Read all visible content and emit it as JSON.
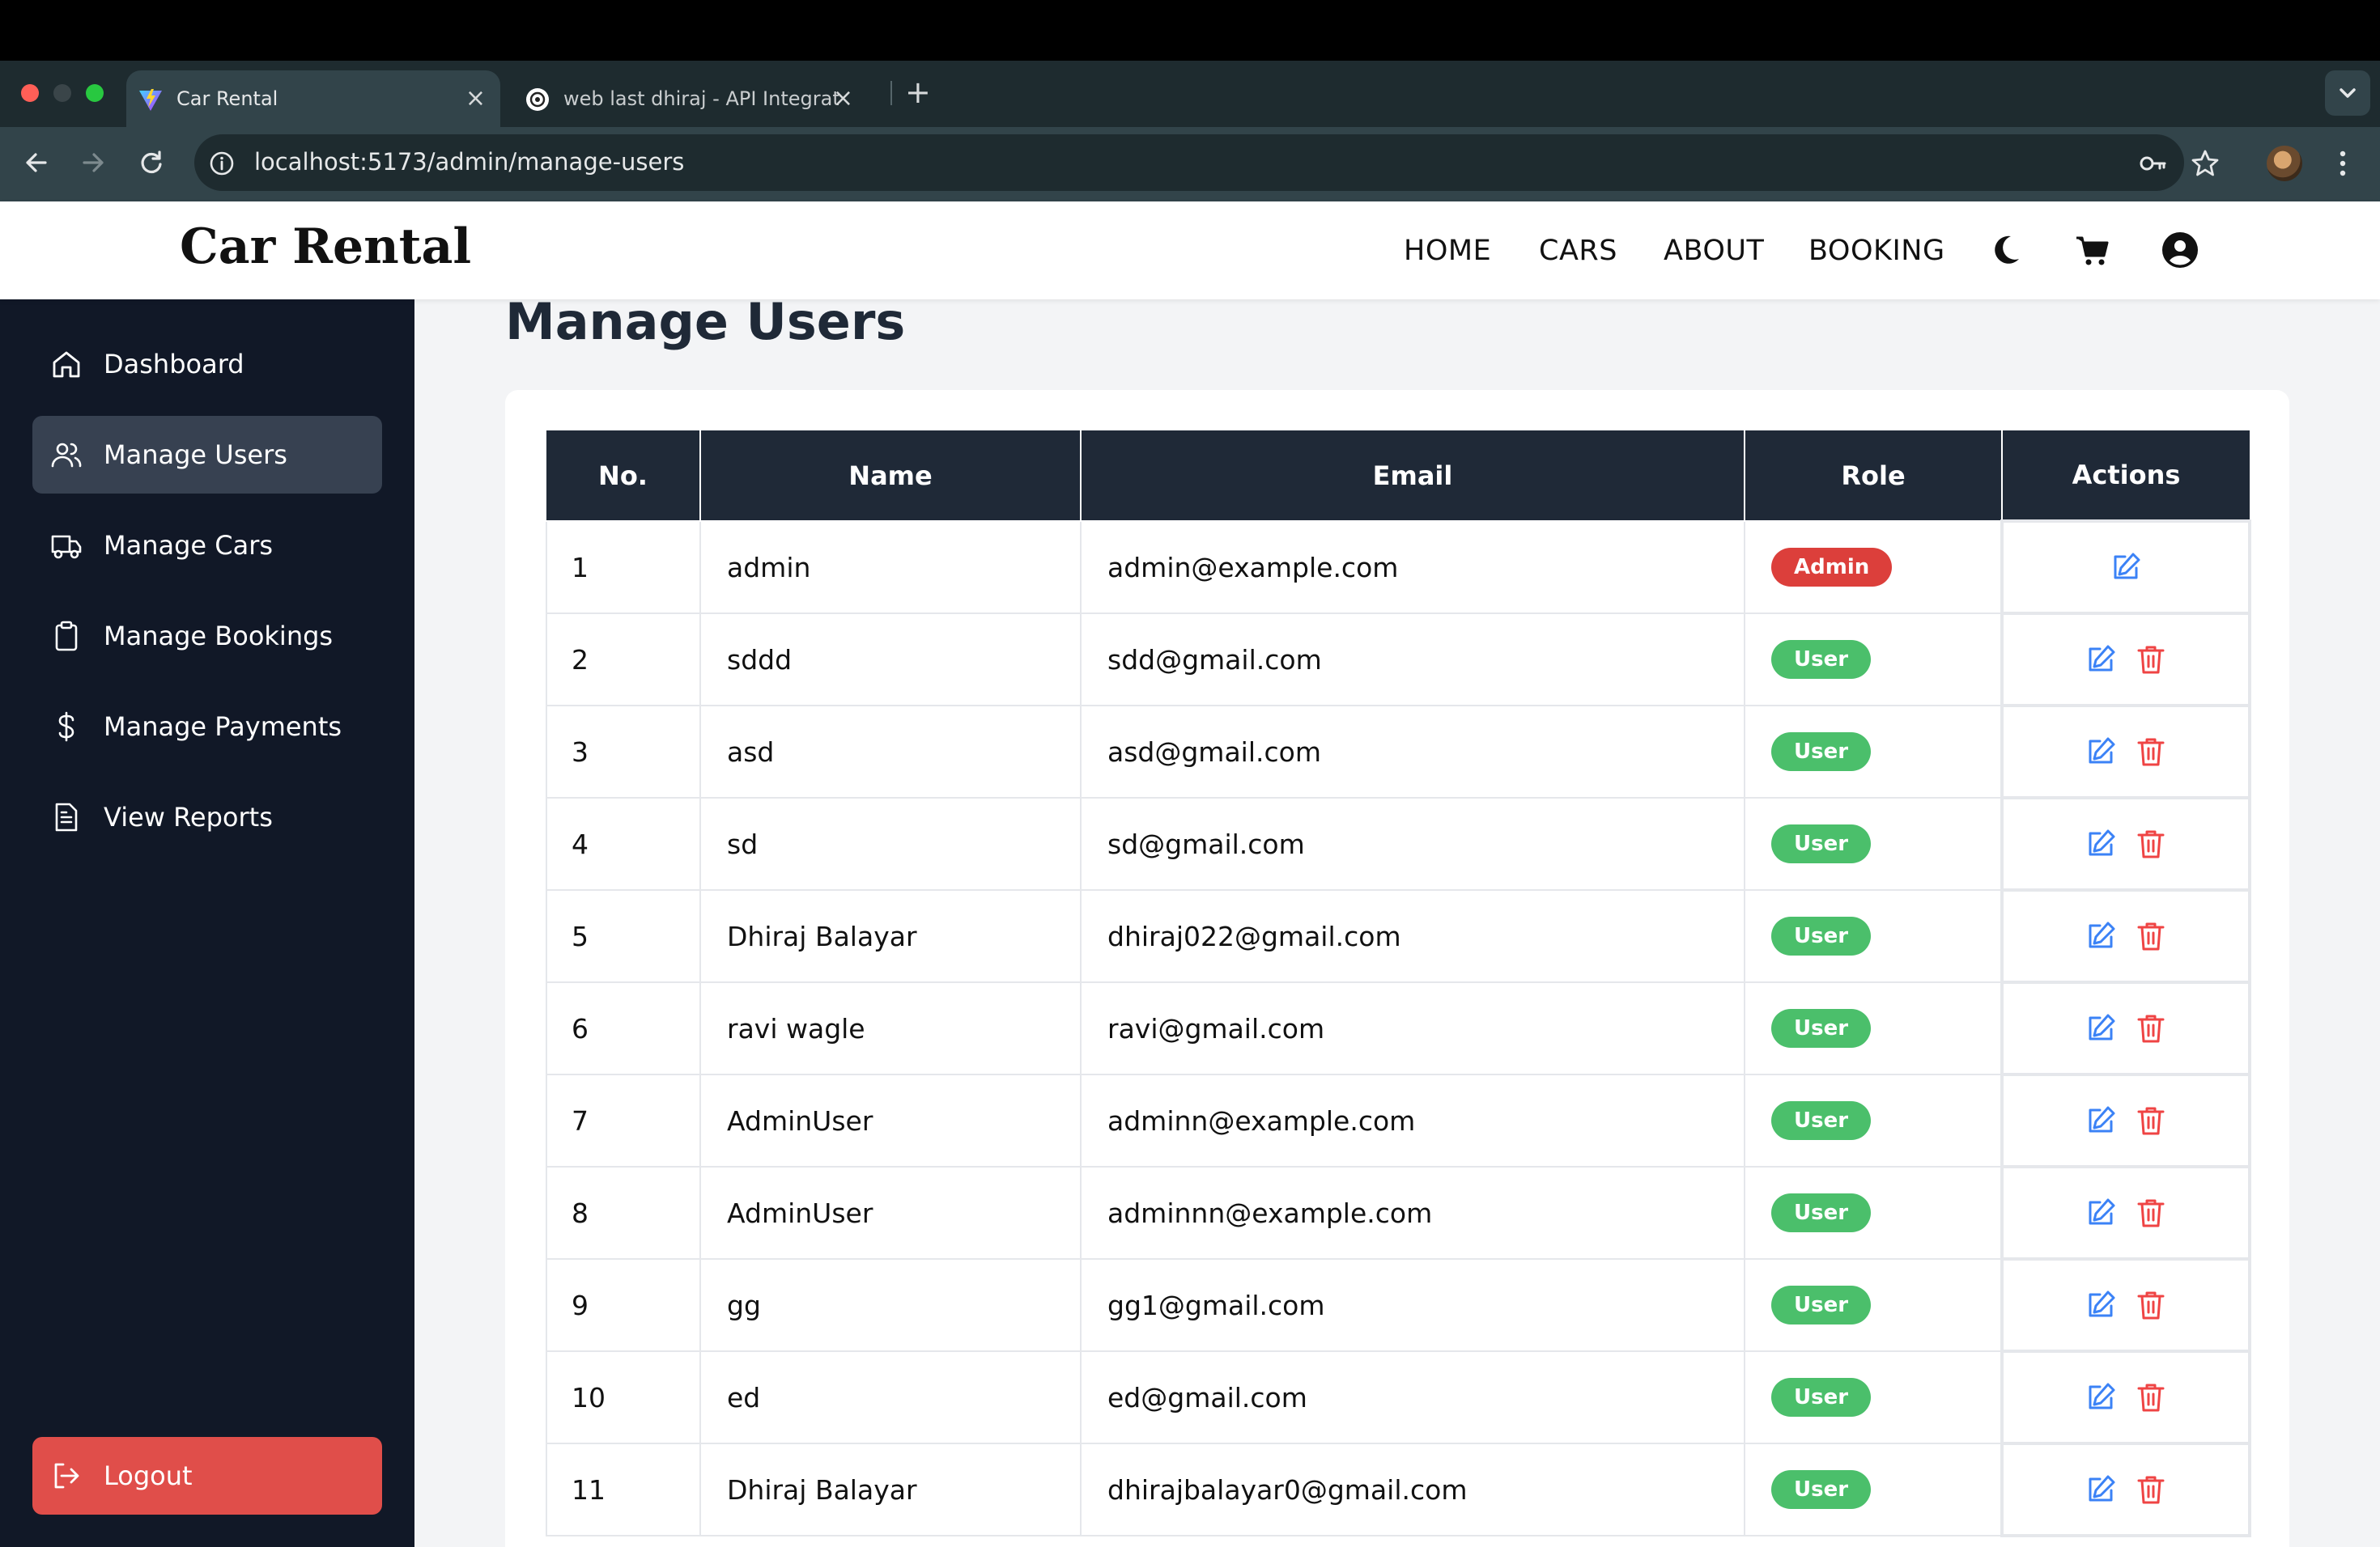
{
  "browser": {
    "tabs": [
      {
        "title": "Car Rental",
        "active": true
      },
      {
        "title": "web last dhiraj - API Integratio",
        "active": false
      }
    ],
    "url": "localhost:5173/admin/manage-users"
  },
  "navbar": {
    "brand": "Car Rental",
    "links": [
      {
        "label": "HOME"
      },
      {
        "label": "CARS"
      },
      {
        "label": "ABOUT"
      },
      {
        "label": "BOOKING"
      }
    ],
    "icons": [
      "moon-icon",
      "cart-icon",
      "user-circle-icon"
    ]
  },
  "sidebar": {
    "items": [
      {
        "label": "Dashboard",
        "icon": "home-icon",
        "active": false
      },
      {
        "label": "Manage Users",
        "icon": "users-icon",
        "active": true
      },
      {
        "label": "Manage Cars",
        "icon": "truck-icon",
        "active": false
      },
      {
        "label": "Manage Bookings",
        "icon": "clipboard-icon",
        "active": false
      },
      {
        "label": "Manage Payments",
        "icon": "dollar-icon",
        "active": false
      },
      {
        "label": "View Reports",
        "icon": "document-icon",
        "active": false
      }
    ],
    "logout_label": "Logout"
  },
  "main": {
    "title": "Manage Users",
    "table": {
      "headers": [
        "No.",
        "Name",
        "Email",
        "Role",
        "Actions"
      ],
      "rows": [
        {
          "no": "1",
          "name": "admin",
          "email": "admin@example.com",
          "role": "Admin"
        },
        {
          "no": "2",
          "name": "sddd",
          "email": "sdd@gmail.com",
          "role": "User"
        },
        {
          "no": "3",
          "name": "asd",
          "email": "asd@gmail.com",
          "role": "User"
        },
        {
          "no": "4",
          "name": "sd",
          "email": "sd@gmail.com",
          "role": "User"
        },
        {
          "no": "5",
          "name": "Dhiraj Balayar",
          "email": "dhiraj022@gmail.com",
          "role": "User"
        },
        {
          "no": "6",
          "name": "ravi wagle",
          "email": "ravi@gmail.com",
          "role": "User"
        },
        {
          "no": "7",
          "name": "AdminUser",
          "email": "adminn@example.com",
          "role": "User"
        },
        {
          "no": "8",
          "name": "AdminUser",
          "email": "adminnn@example.com",
          "role": "User"
        },
        {
          "no": "9",
          "name": "gg",
          "email": "gg1@gmail.com",
          "role": "User"
        },
        {
          "no": "10",
          "name": "ed",
          "email": "ed@gmail.com",
          "role": "User"
        },
        {
          "no": "11",
          "name": "Dhiraj Balayar",
          "email": "dhirajbalayar0@gmail.com",
          "role": "User"
        }
      ]
    }
  },
  "colors": {
    "sidebar_bg": "#111827",
    "sidebar_active": "#374151",
    "table_header": "#1f2937",
    "admin_badge": "#dc3f3b",
    "user_badge": "#4bbf6b",
    "edit_icon": "#3b82f6",
    "delete_icon": "#ef4444",
    "logout_bg": "#e04e4a"
  }
}
